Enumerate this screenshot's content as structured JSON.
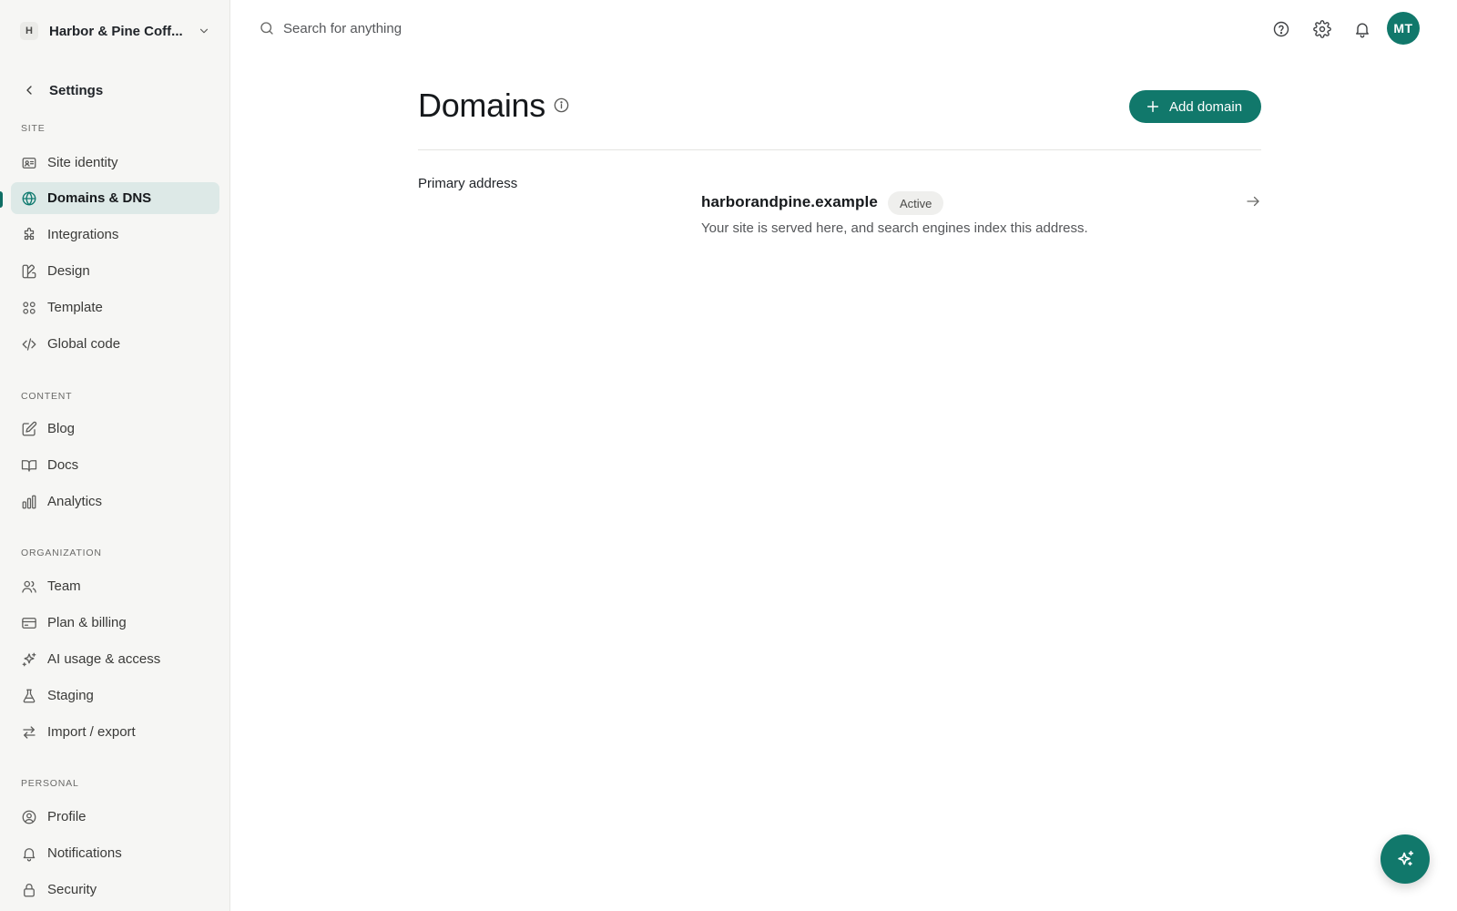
{
  "workspace": {
    "initial": "H",
    "name": "Harbor & Pine Coff..."
  },
  "settings_back_label": "Settings",
  "sections": {
    "site": "SITE",
    "content": "CONTENT",
    "organization": "ORGANIZATION",
    "personal": "PERSONAL"
  },
  "nav": {
    "site_identity": "Site identity",
    "domains_dns": "Domains & DNS",
    "integrations": "Integrations",
    "design": "Design",
    "template": "Template",
    "global_code": "Global code",
    "blog": "Blog",
    "docs": "Docs",
    "analytics": "Analytics",
    "team": "Team",
    "plan_billing": "Plan & billing",
    "ai_usage": "AI usage & access",
    "staging": "Staging",
    "import_export": "Import / export",
    "profile": "Profile",
    "notifications": "Notifications",
    "security": "Security"
  },
  "active_nav": "Domains & DNS",
  "search": {
    "placeholder": "Search for anything",
    "value": ""
  },
  "user": {
    "initials": "MT"
  },
  "page": {
    "title": "Domains",
    "add_button_label": "Add domain",
    "section_title": "Primary address",
    "domain": {
      "name": "harborandpine.example",
      "status": "Active",
      "description": "Your site is served here, and search engines index this address."
    }
  },
  "colors": {
    "accent": "#11786b",
    "sidebar_bg": "#f6f6f4",
    "active_item_bg": "#dde9e7"
  },
  "icons": {
    "search": "search-icon",
    "help": "help-circle-icon",
    "settings": "gear-icon",
    "notifications": "bell-icon",
    "fab": "sparkles-icon"
  }
}
